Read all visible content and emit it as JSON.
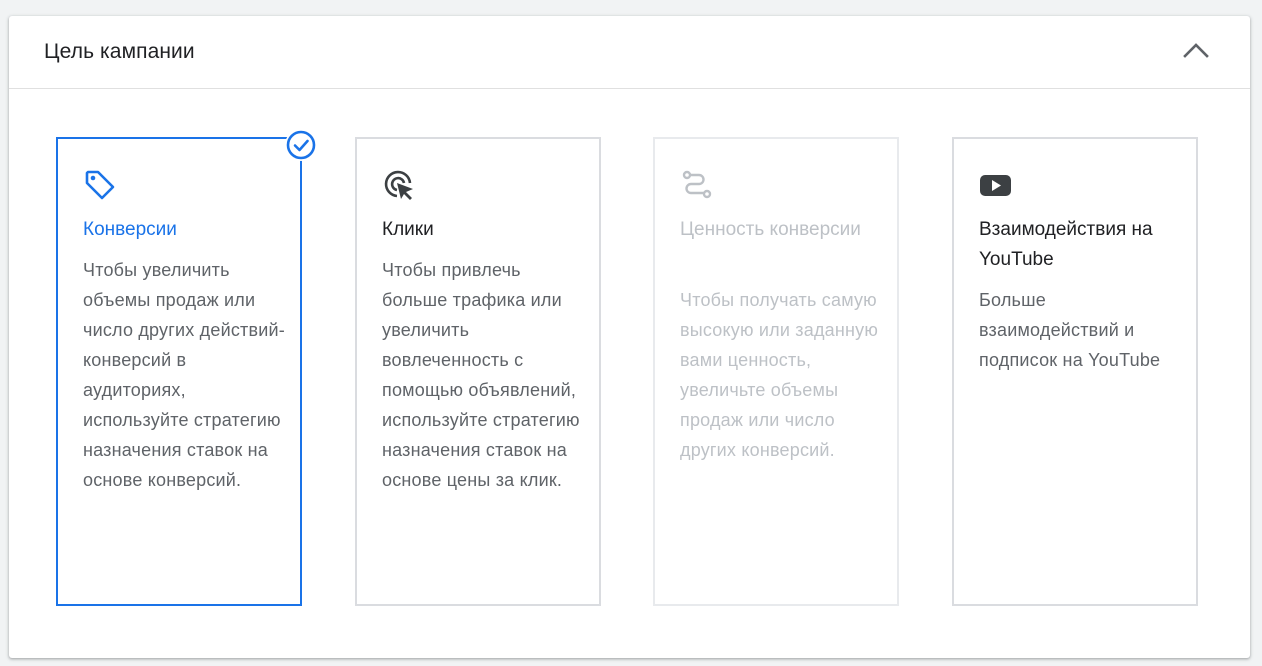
{
  "section": {
    "title": "Цель кампании",
    "collapse_icon": "chevron-up-icon"
  },
  "colors": {
    "accent": "#1a73e8",
    "text": "#202124",
    "secondary_text": "#5f6368",
    "disabled_text": "#bdc1c6"
  },
  "goals": [
    {
      "title": "Конверсии",
      "description": "Чтобы увеличить объемы продаж или число других действий-конверсий в аудиториях, используйте стратегию назначения ставок на основе конверсий.",
      "icon": "tag-icon",
      "selected": true,
      "disabled": false
    },
    {
      "title": "Клики",
      "description": "Чтобы привлечь больше трафика или увеличить вовлеченность с помощью объявлений, используйте стратегию назначения ставок на основе цены за клик.",
      "icon": "cursor-click-icon",
      "selected": false,
      "disabled": false
    },
    {
      "title": "Ценность конверсии",
      "description": "Чтобы получать самую высокую или заданную вами ценность, увеличьте объемы продаж или число других конверсий.",
      "icon": "route-icon",
      "selected": false,
      "disabled": true
    },
    {
      "title": "Взаимодействия на YouTube",
      "description": "Больше взаимодействий и подписок на YouTube",
      "icon": "youtube-icon",
      "selected": false,
      "disabled": false
    }
  ]
}
